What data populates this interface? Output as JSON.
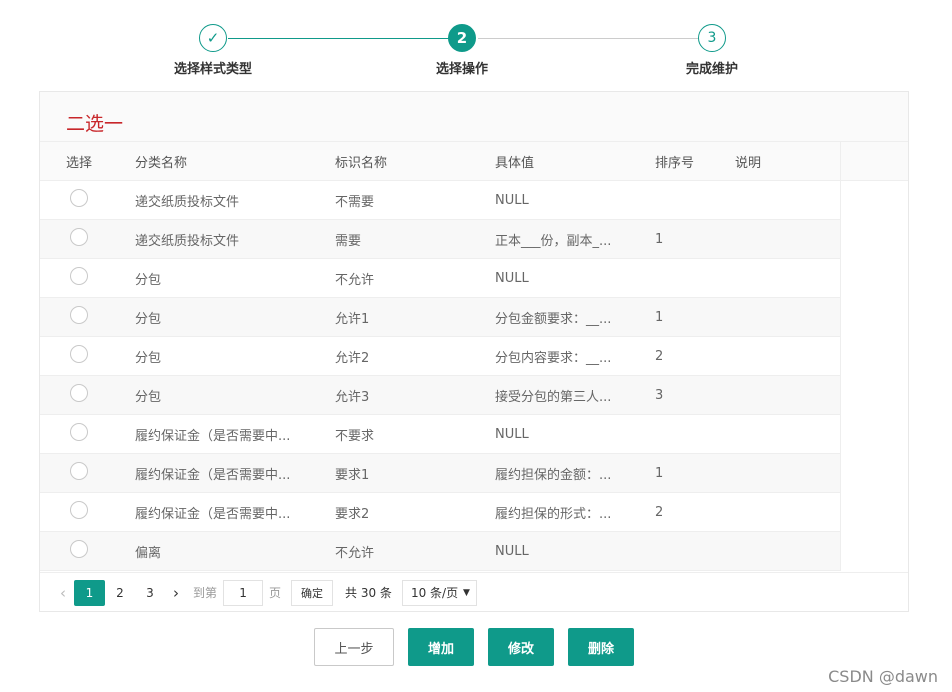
{
  "steps": [
    {
      "label": "选择样式类型",
      "state": "done",
      "mark": "✓"
    },
    {
      "label": "选择操作",
      "state": "active",
      "mark": "2"
    },
    {
      "label": "完成维护",
      "state": "todo",
      "mark": "3"
    }
  ],
  "panel": {
    "title": "二选一",
    "columns": {
      "select": "选择",
      "category": "分类名称",
      "identifier": "标识名称",
      "value": "具体值",
      "order": "排序号",
      "description": "说明"
    },
    "rows": [
      {
        "category": "递交纸质投标文件",
        "identifier": "不需要",
        "value": "NULL",
        "order": "",
        "description": ""
      },
      {
        "category": "递交纸质投标文件",
        "identifier": "需要",
        "value": "正本___份，副本_...",
        "order": "1",
        "description": ""
      },
      {
        "category": "分包",
        "identifier": "不允许",
        "value": "NULL",
        "order": "",
        "description": ""
      },
      {
        "category": "分包",
        "identifier": "允许1",
        "value": "分包金额要求：__...",
        "order": "1",
        "description": ""
      },
      {
        "category": "分包",
        "identifier": "允许2",
        "value": "分包内容要求：__...",
        "order": "2",
        "description": ""
      },
      {
        "category": "分包",
        "identifier": "允许3",
        "value": "接受分包的第三人...",
        "order": "3",
        "description": ""
      },
      {
        "category": "履约保证金（是否需要中...",
        "identifier": "不要求",
        "value": "NULL",
        "order": "",
        "description": ""
      },
      {
        "category": "履约保证金（是否需要中...",
        "identifier": "要求1",
        "value": "履约担保的金额：...",
        "order": "1",
        "description": ""
      },
      {
        "category": "履约保证金（是否需要中...",
        "identifier": "要求2",
        "value": "履约担保的形式：...",
        "order": "2",
        "description": ""
      },
      {
        "category": "偏离",
        "identifier": "不允许",
        "value": "NULL",
        "order": "",
        "description": ""
      }
    ]
  },
  "pagination": {
    "prev_icon": "chevron-left-icon",
    "next_icon": "chevron-right-icon",
    "pages": [
      "1",
      "2",
      "3"
    ],
    "current_page": "1",
    "goto_label": "到第",
    "goto_value": "1",
    "page_unit": "页",
    "confirm_label": "确定",
    "total_label": "共 30 条",
    "page_size": "10 条/页",
    "dropdown_icon": "▼"
  },
  "actions": {
    "prev_label": "上一步",
    "add_label": "增加",
    "edit_label": "修改",
    "delete_label": "删除"
  },
  "watermark": "CSDN @dawn",
  "colors": {
    "accent": "#0f9a8a",
    "title_red": "#c8262a"
  }
}
